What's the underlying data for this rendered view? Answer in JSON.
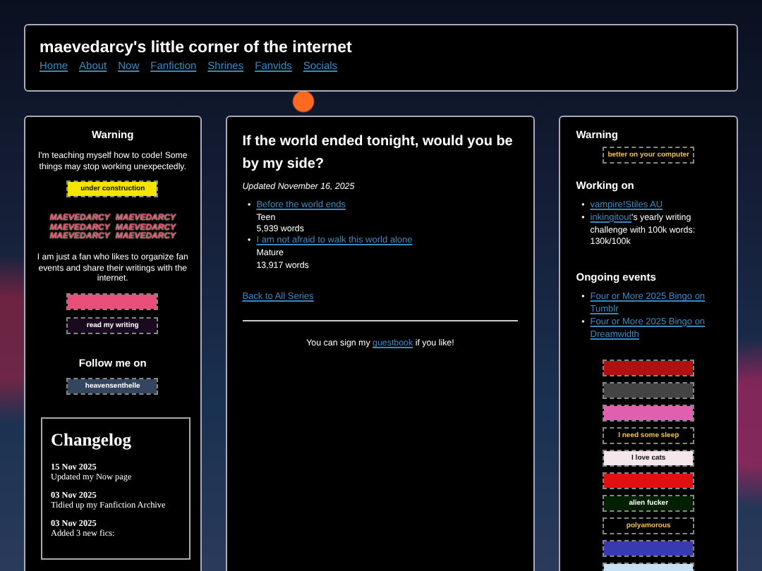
{
  "header": {
    "title": "maevedarcy's little corner of the internet",
    "nav": [
      "Home",
      "About",
      "Now",
      "Fanfiction",
      "Shrines",
      "Fanvids",
      "Socials"
    ]
  },
  "left": {
    "warning_title": "Warning",
    "warning_text": "I'm teaching myself how to code! Some things may stop working unexpectedly.",
    "construction_stamp": {
      "text": "under construction",
      "color": "#f5e400"
    },
    "name_graphic": [
      "MAEVEDARCY",
      "MAEVEDARCY",
      "MAEVEDARCY",
      "MAEVEDARCY",
      "MAEVEDARCY",
      "MAEVEDARCY"
    ],
    "about_text": "I am just a fan who likes to organize fan events and share their writings with the internet.",
    "stamps": [
      {
        "color": "#e8507a"
      },
      {
        "text": "read my writing",
        "color": "#1a0a20"
      }
    ],
    "follow_title": "Follow me on",
    "tumblr_stamp": {
      "text": "heavensenthelle",
      "color": "#34465d"
    },
    "changelog": {
      "title": "Changelog",
      "entries": [
        {
          "date": "15 Nov 2025",
          "text": "Updated my Now page"
        },
        {
          "date": "03 Nov 2025",
          "text": "Tidied up my Fanfiction Archive"
        },
        {
          "date": "03 Nov 2025",
          "text": "Added 3 new fics:"
        }
      ]
    }
  },
  "main": {
    "title": "If the world ended tonight, would you be by my side?",
    "updated": "Updated November 16, 2025",
    "works": [
      {
        "marker": "•",
        "title": "Before the world ends",
        "rating": "Teen",
        "words": "5,939 words"
      },
      {
        "marker": "•",
        "title": "I am not afraid to walk this world alone",
        "rating": "Mature",
        "words": "13,917 words"
      }
    ],
    "back_link": "Back to All Series",
    "guestbook": "You can sign my **guestbook** if you like!"
  },
  "right": {
    "warning_title": "Warning",
    "warning_stamp": {
      "text": "better on your computer",
      "color": "#000000"
    },
    "working_title": "Working on",
    "working": [
      {
        "marker": "•",
        "link": "vampire!Stiles AU"
      },
      {
        "marker": "•",
        "link": "inkingitout",
        "rest": "'s yearly writing challenge with 100k words: 130k/100k"
      }
    ],
    "events_title": "Ongoing events",
    "events": [
      {
        "marker": "•",
        "text": "Four or More 2025 Bingo on Tumblr"
      },
      {
        "marker": "•",
        "text": "Four or More 2025 Bingo on Dreamwidth"
      }
    ],
    "stamps": [
      {
        "color": "#b01010"
      },
      {
        "color": "#444444"
      },
      {
        "color": "#e060b0"
      },
      {
        "text": "I need some sleep",
        "color": "#000000"
      },
      {
        "text": "I love cats",
        "color": "#f4e6ea"
      },
      {
        "color": "#e01010"
      },
      {
        "text": "alien fucker",
        "color": "#002000"
      },
      {
        "text": "polyamorous",
        "color": "#000000"
      },
      {
        "color": "#3a3ab0"
      },
      {
        "color": "#c8e0f4"
      }
    ]
  }
}
